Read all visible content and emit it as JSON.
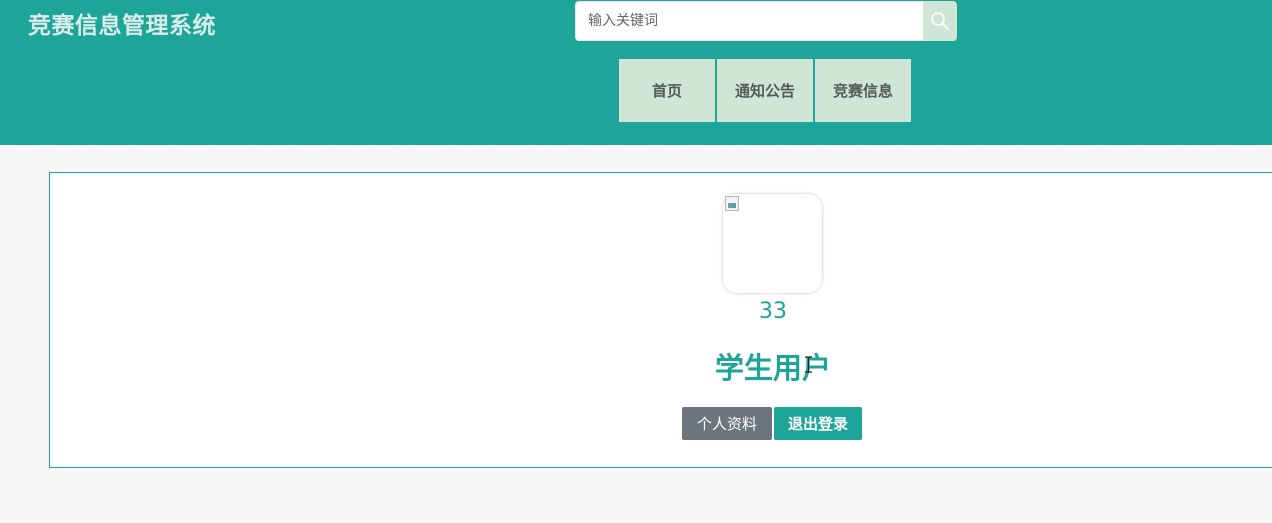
{
  "header": {
    "site_title": "竞赛信息管理系统",
    "search": {
      "placeholder": "输入关键词",
      "value": "",
      "button_icon": "search-icon"
    },
    "nav": [
      {
        "label": "首页"
      },
      {
        "label": "通知公告"
      },
      {
        "label": "竞赛信息"
      }
    ]
  },
  "profile": {
    "avatar_icon": "broken-image-icon",
    "user_id": "33",
    "user_name": "学生用户",
    "buttons": {
      "profile_label": "个人资料",
      "logout_label": "退出登录"
    }
  },
  "colors": {
    "primary": "#1ea599",
    "nav_bg": "#cfe6d7",
    "secondary_button": "#6c757d",
    "page_bg": "#f7f7f7"
  }
}
